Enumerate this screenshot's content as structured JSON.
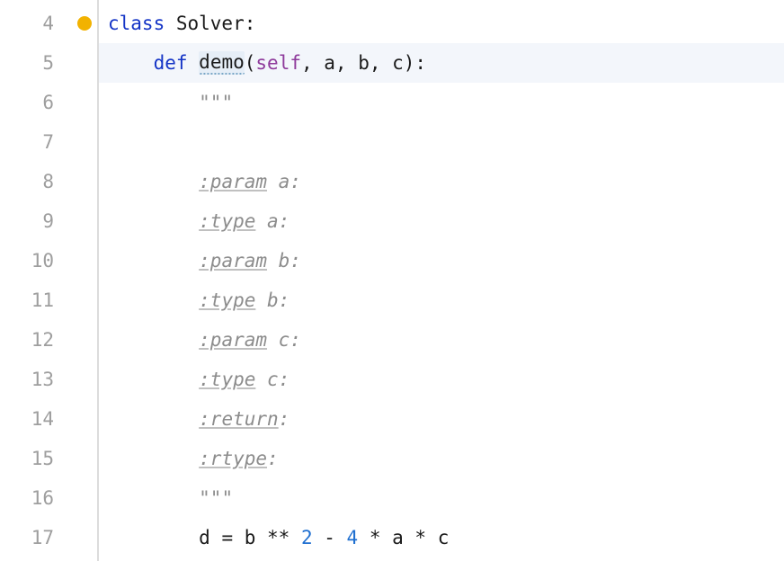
{
  "lines": {
    "4": {
      "num": "4",
      "kw_class": "class",
      "class_name": " Solver:"
    },
    "5": {
      "num": "5",
      "kw_def": "def",
      "fn_name": "demo",
      "paren_open": "(",
      "self": "self",
      "params_rest": ", a, b, c):"
    },
    "6": {
      "num": "6",
      "triple": "\"\"\""
    },
    "7": {
      "num": "7"
    },
    "8": {
      "num": "8",
      "tag": ":param",
      "rest": " a:"
    },
    "9": {
      "num": "9",
      "tag": ":type",
      "rest": " a:"
    },
    "10": {
      "num": "10",
      "tag": ":param",
      "rest": " b:"
    },
    "11": {
      "num": "11",
      "tag": ":type",
      "rest": " b:"
    },
    "12": {
      "num": "12",
      "tag": ":param",
      "rest": " c:"
    },
    "13": {
      "num": "13",
      "tag": ":type",
      "rest": " c:"
    },
    "14": {
      "num": "14",
      "tag": ":return",
      "rest": ":"
    },
    "15": {
      "num": "15",
      "tag": ":rtype",
      "rest": ":"
    },
    "16": {
      "num": "16",
      "triple": "\"\"\""
    },
    "17": {
      "num": "17",
      "pre": "d = b ** ",
      "n1": "2",
      "mid1": " - ",
      "n2": "4",
      "mid2": " * a * c"
    }
  },
  "indent": {
    "i1": "    ",
    "i2": "        "
  }
}
